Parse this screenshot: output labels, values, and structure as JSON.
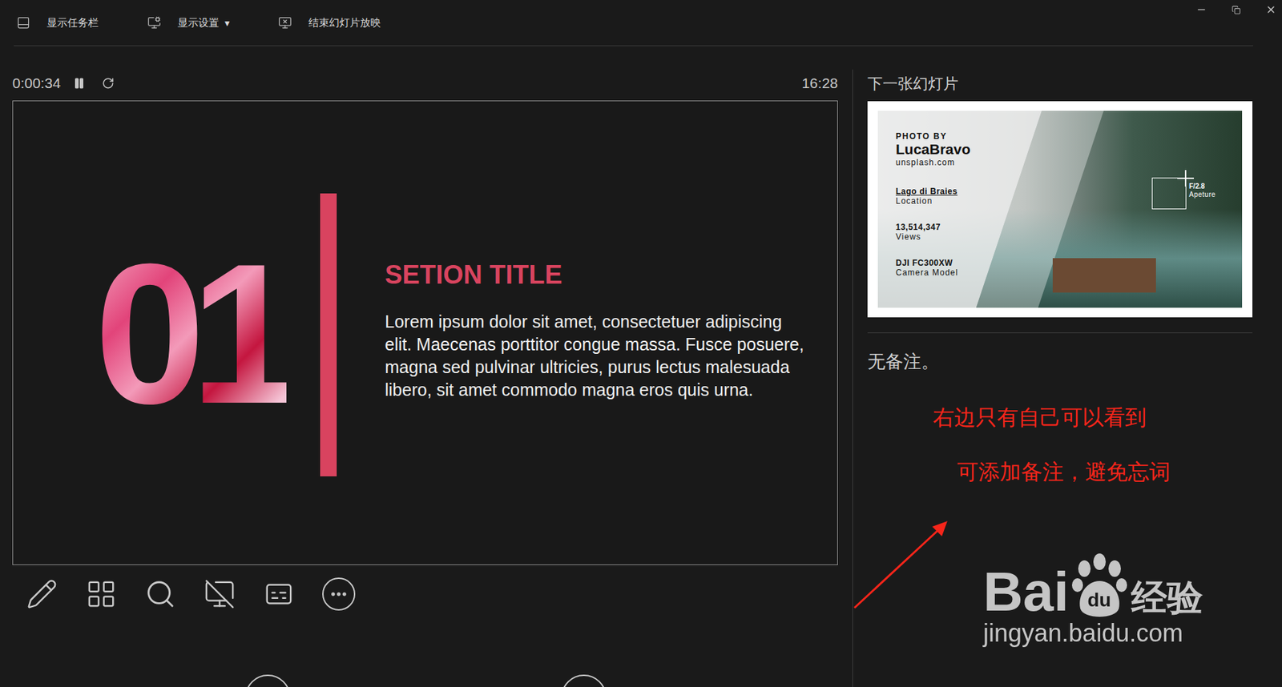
{
  "toolbar": [
    {
      "label": "显示任务栏",
      "caret": ""
    },
    {
      "label": "显示设置",
      "caret": "▼"
    },
    {
      "label": "结束幻灯片放映",
      "caret": ""
    }
  ],
  "timer": {
    "elapsed": "0:00:34",
    "running": true,
    "clock": "16:28"
  },
  "slide": {
    "number": "01",
    "title": "SETION TITLE",
    "body": "Lorem ipsum dolor sit amet, consectetuer adipiscing elit. Maecenas porttitor congue massa. Fusce posuere, magna sed pulvinar ultricies, purus lectus malesuada libero, sit amet commodo magna eros quis urna."
  },
  "next_slide": {
    "heading": "下一张幻灯片",
    "photo_by": "PHOTO BY",
    "author": "LucaBravo",
    "site": "unsplash.com",
    "facts": [
      {
        "value": "Lago di Braies",
        "label": "Location",
        "underlined": true
      },
      {
        "value": "13,514,347",
        "label": "Views",
        "underlined": false
      },
      {
        "value": "DJI FC300XW",
        "label": "Camera Model",
        "underlined": false
      }
    ],
    "aperture": {
      "value": "F/2.8",
      "label": "Apeture"
    }
  },
  "notes": "无备注。",
  "annotations": [
    "右边只有自己可以看到",
    "可添加备注，避免忘词"
  ],
  "watermark": {
    "left": "Bai",
    "paw": "du",
    "right": "经验",
    "url": "jingyan.baidu.com"
  }
}
